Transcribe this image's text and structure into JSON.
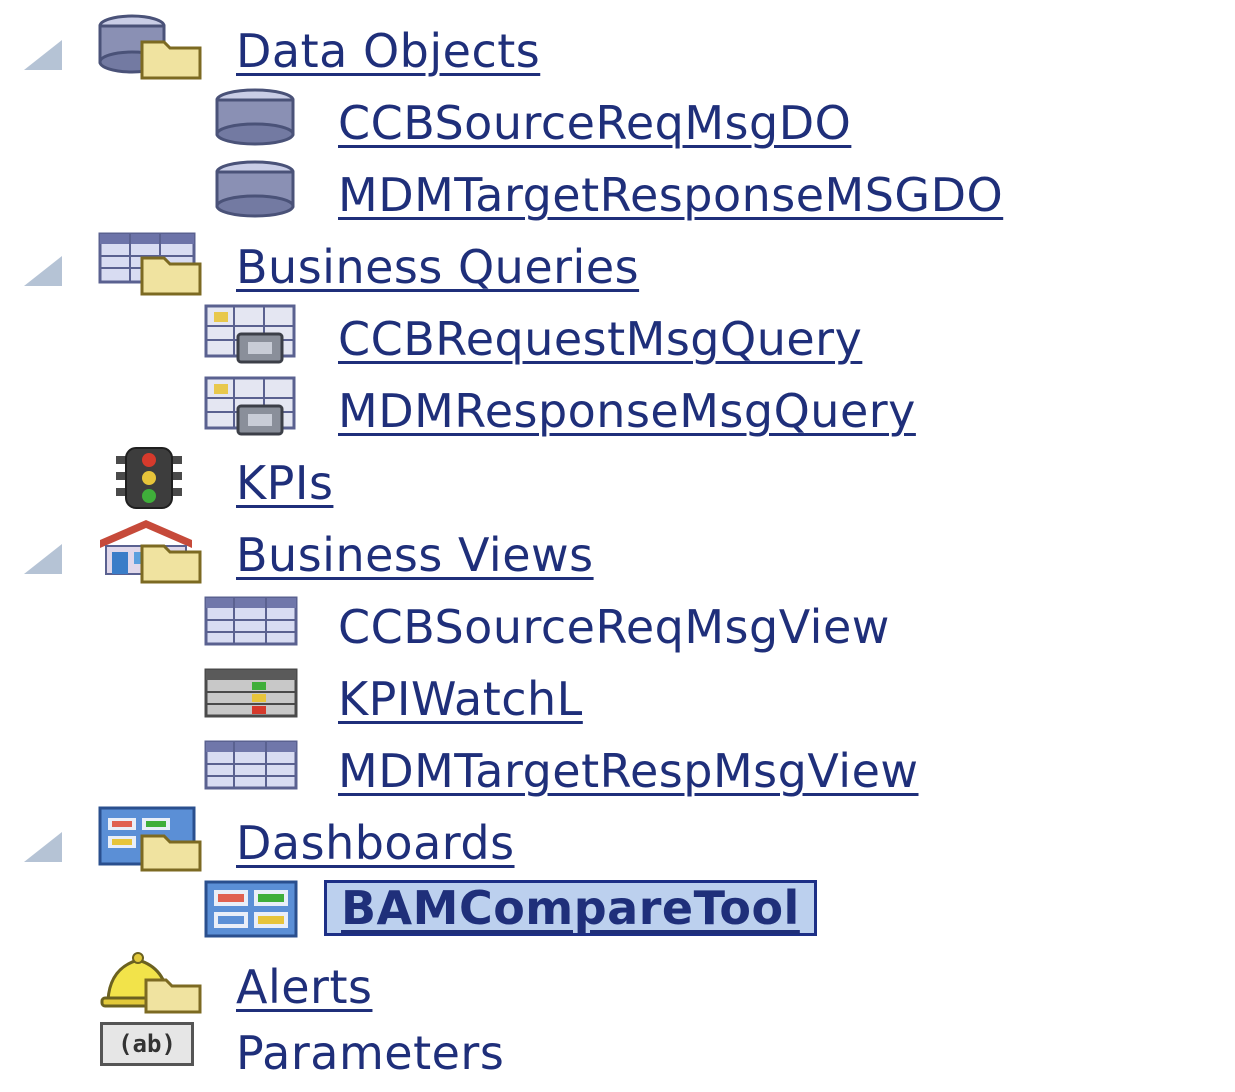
{
  "tree": {
    "data_objects": {
      "label": "Data Objects",
      "children": [
        "CCBSourceReqMsgDO",
        "MDMTargetResponseMSGDO"
      ]
    },
    "business_queries": {
      "label": "Business Queries",
      "children": [
        "CCBRequestMsgQuery",
        "MDMResponseMsgQuery"
      ]
    },
    "kpis": {
      "label": "KPIs"
    },
    "business_views": {
      "label": "Business Views",
      "children": [
        "CCBSourceReqMsgView",
        "KPIWatchL",
        "MDMTargetRespMsgView"
      ]
    },
    "dashboards": {
      "label": "Dashboards",
      "children": [
        "BAMCompareTool"
      ],
      "selected": "BAMCompareTool"
    },
    "alerts": {
      "label": "Alerts"
    },
    "parameters": {
      "label": "Parameters",
      "icon_text": "(ab)"
    }
  },
  "colors": {
    "link": "#1f2f7a",
    "selection_bg": "#bcd0ee",
    "selection_border": "#1d2f86"
  }
}
